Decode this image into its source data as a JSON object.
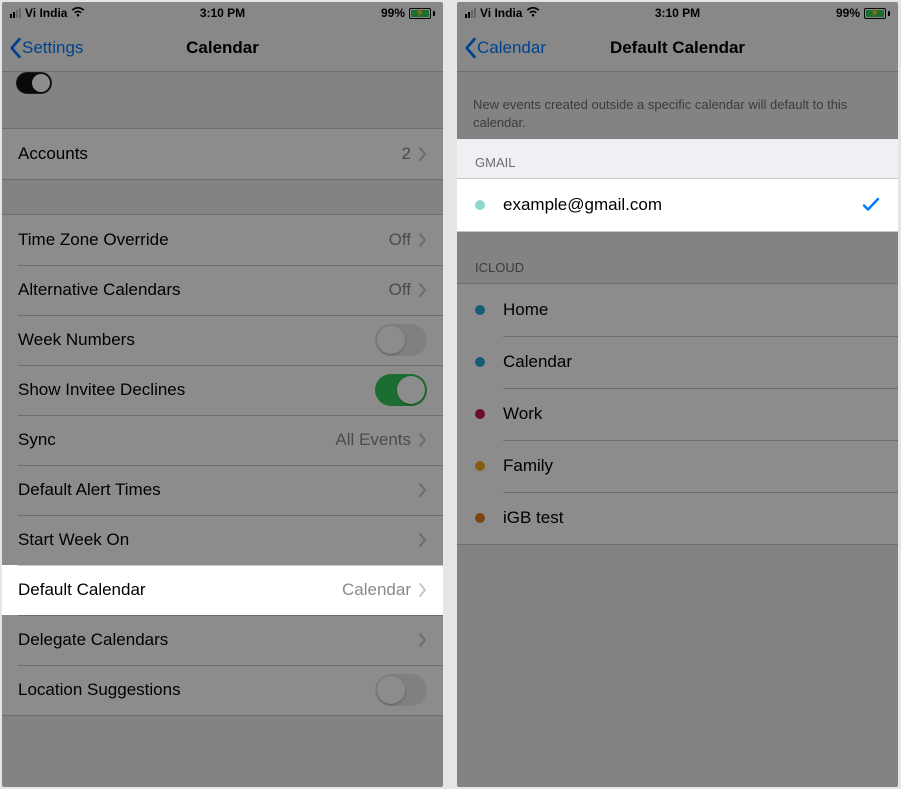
{
  "status": {
    "carrier": "Vi India",
    "time": "3:10 PM",
    "battery_pct": "99%"
  },
  "screen1": {
    "back_label": "Settings",
    "title": "Calendar",
    "rows": {
      "accounts": {
        "label": "Accounts",
        "value": "2"
      },
      "tz_override": {
        "label": "Time Zone Override",
        "value": "Off"
      },
      "alt_calendars": {
        "label": "Alternative Calendars",
        "value": "Off"
      },
      "week_numbers": {
        "label": "Week Numbers"
      },
      "invitee_declines": {
        "label": "Show Invitee Declines"
      },
      "sync": {
        "label": "Sync",
        "value": "All Events"
      },
      "default_alert_times": {
        "label": "Default Alert Times"
      },
      "start_week_on": {
        "label": "Start Week On"
      },
      "default_calendar": {
        "label": "Default Calendar",
        "value": "Calendar"
      },
      "delegate_calendars": {
        "label": "Delegate Calendars"
      },
      "location_suggestions": {
        "label": "Location Suggestions"
      }
    }
  },
  "screen2": {
    "back_label": "Calendar",
    "title": "Default Calendar",
    "description": "New events created outside a specific calendar will default to this calendar.",
    "sections": {
      "gmail": {
        "header": "GMAIL",
        "items": [
          {
            "name": "example@gmail.com",
            "color": "#8fd9cc",
            "selected": true
          }
        ]
      },
      "icloud": {
        "header": "ICLOUD",
        "items": [
          {
            "name": "Home",
            "color": "#2aa4d7",
            "selected": false
          },
          {
            "name": "Calendar",
            "color": "#2aa4d7",
            "selected": false
          },
          {
            "name": "Work",
            "color": "#c2185b",
            "selected": false
          },
          {
            "name": "Family",
            "color": "#f5a623",
            "selected": false
          },
          {
            "name": "iGB test",
            "color": "#e07b1f",
            "selected": false
          }
        ]
      }
    }
  }
}
